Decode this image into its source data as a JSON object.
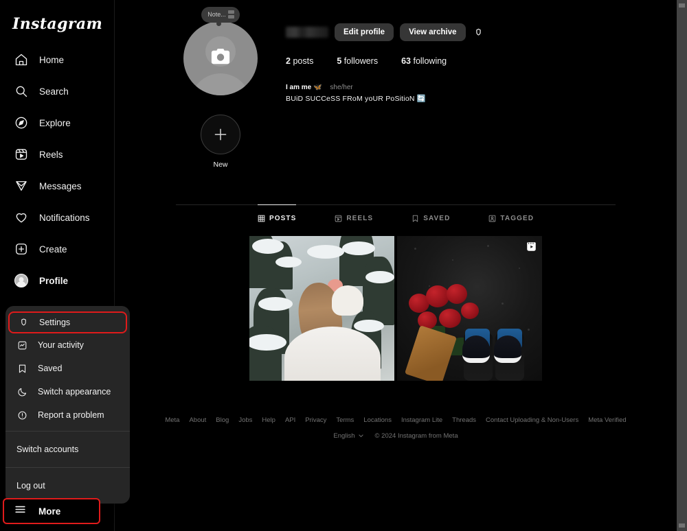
{
  "brand": {
    "name": "Instagram"
  },
  "sidebar": {
    "items": [
      {
        "label": "Home",
        "icon": "home-icon"
      },
      {
        "label": "Search",
        "icon": "search-icon"
      },
      {
        "label": "Explore",
        "icon": "compass-icon"
      },
      {
        "label": "Reels",
        "icon": "reels-icon"
      },
      {
        "label": "Messages",
        "icon": "messenger-icon"
      },
      {
        "label": "Notifications",
        "icon": "heart-icon"
      },
      {
        "label": "Create",
        "icon": "plus-square-icon"
      },
      {
        "label": "Profile",
        "icon": "avatar-icon"
      }
    ],
    "more_label": "More"
  },
  "menu": {
    "items": [
      {
        "label": "Settings",
        "icon": "gear-icon",
        "highlighted": true
      },
      {
        "label": "Your activity",
        "icon": "activity-icon",
        "highlighted": false
      },
      {
        "label": "Saved",
        "icon": "bookmark-icon",
        "highlighted": false
      },
      {
        "label": "Switch appearance",
        "icon": "moon-icon",
        "highlighted": false
      },
      {
        "label": "Report a problem",
        "icon": "alert-circle-icon",
        "highlighted": false
      }
    ],
    "switch_accounts": "Switch accounts",
    "log_out": "Log out"
  },
  "profile": {
    "note_label": "Note...",
    "username_redacted": true,
    "edit_profile_label": "Edit profile",
    "view_archive_label": "View archive",
    "stats": [
      {
        "count": "2",
        "label": "posts"
      },
      {
        "count": "5",
        "label": "followers"
      },
      {
        "count": "63",
        "label": "following"
      }
    ],
    "bio_name": "I am me 🦋",
    "pronouns": "she/her",
    "bio_text": "BUiD SUCCeSS FRoM yoUR PoSitioN 🔄",
    "highlights": [
      {
        "label": "New",
        "icon": "plus-icon"
      }
    ]
  },
  "tabs": [
    {
      "label": "POSTS",
      "icon": "grid-icon",
      "active": true
    },
    {
      "label": "REELS",
      "icon": "reels-icon",
      "active": false
    },
    {
      "label": "SAVED",
      "icon": "bookmark-icon",
      "active": false
    },
    {
      "label": "TAGGED",
      "icon": "tagged-icon",
      "active": false
    }
  ],
  "posts": [
    {
      "alt": "Person in white sweater facing snowy pine forest",
      "badge": null
    },
    {
      "alt": "Red roses and sneakers on wet asphalt",
      "badge": "reels-badge-icon"
    }
  ],
  "footer": {
    "links": [
      "Meta",
      "About",
      "Blog",
      "Jobs",
      "Help",
      "API",
      "Privacy",
      "Terms",
      "Locations",
      "Instagram Lite",
      "Threads",
      "Contact Uploading & Non-Users",
      "Meta Verified"
    ],
    "language": "English",
    "copyright": "© 2024 Instagram from Meta"
  },
  "colors": {
    "background": "#000000",
    "surface": "#262626",
    "button": "#363636",
    "accent_highlight": "#e01b1b",
    "text_primary": "#f2f2f2",
    "text_muted": "#8e8e8e",
    "footer_text": "#737373"
  }
}
